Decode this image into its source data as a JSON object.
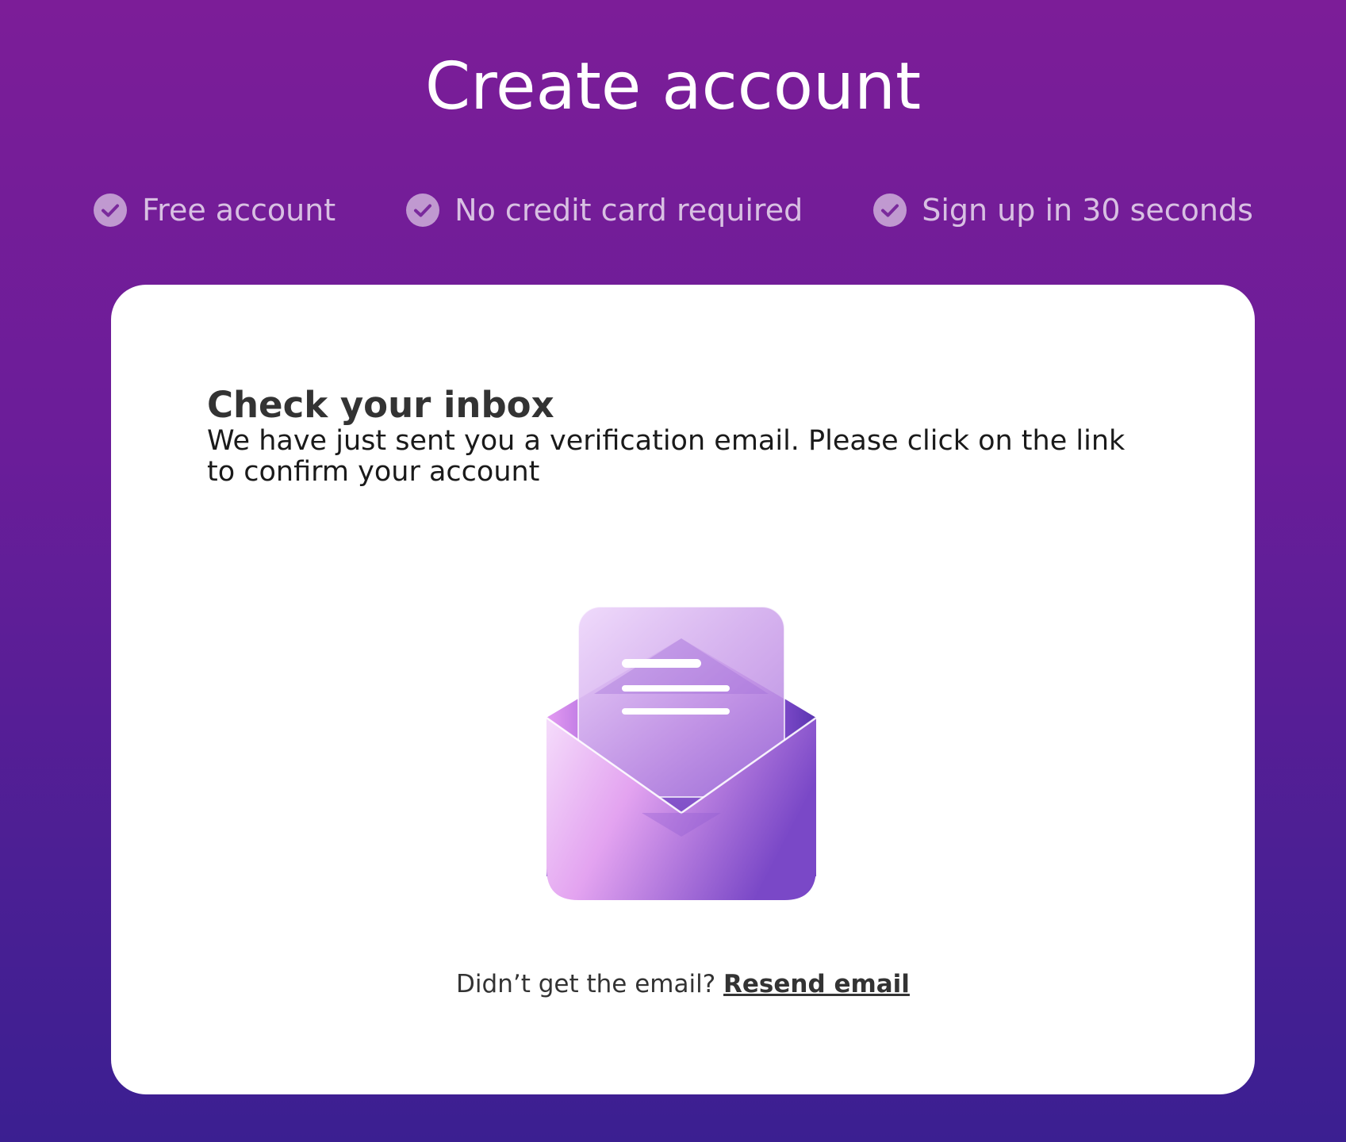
{
  "header": {
    "title": "Create account"
  },
  "features": [
    {
      "label": "Free account",
      "icon": "check-circle-icon"
    },
    {
      "label": "No credit card required",
      "icon": "check-circle-icon"
    },
    {
      "label": "Sign up in 30 seconds",
      "icon": "check-circle-icon"
    }
  ],
  "card": {
    "heading": "Check your inbox",
    "message": "We have just sent you a verification email. Please click on the link to confirm your account",
    "illustration": "open-envelope-icon",
    "resend_prompt": "Didn’t get the email?",
    "resend_link": "Resend email"
  },
  "colors": {
    "background_top": "#7c1d98",
    "background_bottom": "#3b1f91",
    "card_background": "#ffffff",
    "envelope_accent": "#b86be0"
  }
}
